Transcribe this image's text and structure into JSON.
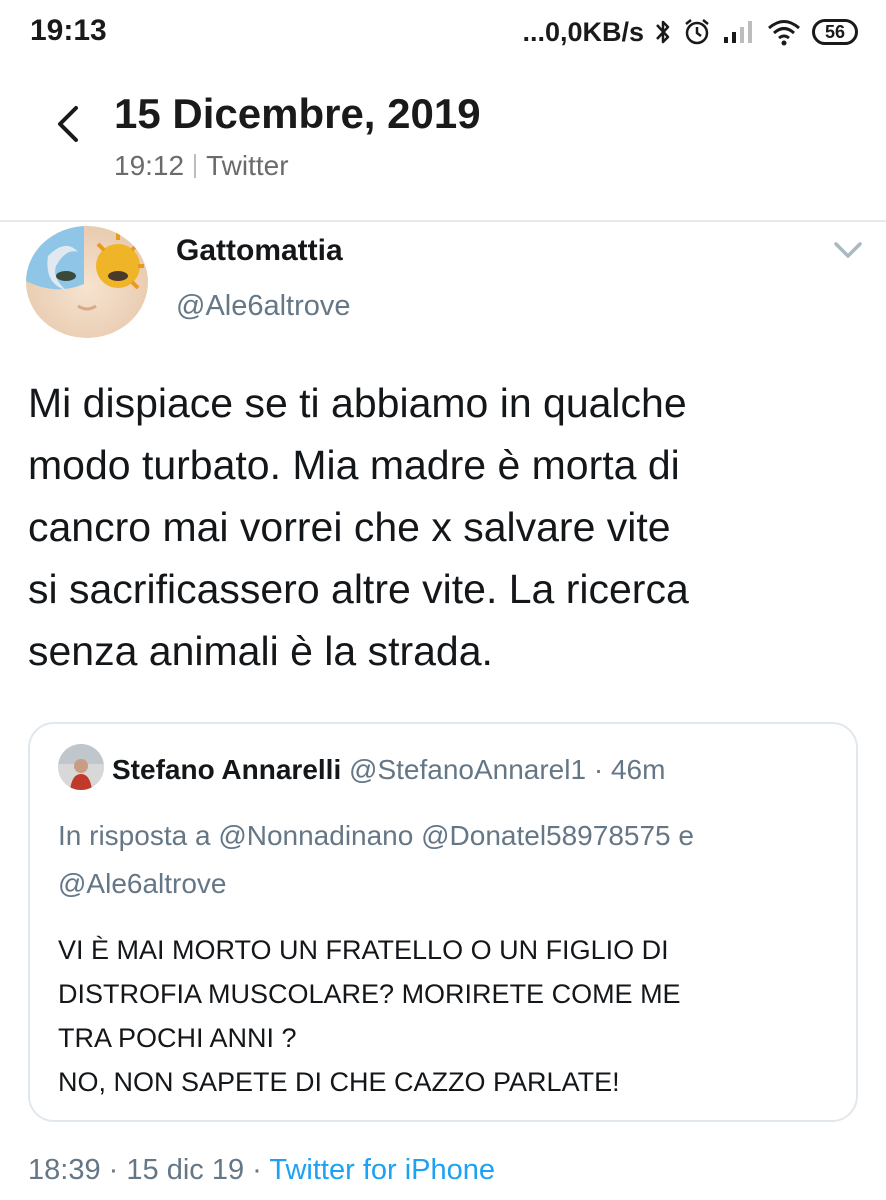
{
  "status_bar": {
    "time": "19:13",
    "speed": "...0,0KB/s",
    "battery": "56"
  },
  "header": {
    "title": "15 Dicembre, 2019",
    "sub_time": "19:12",
    "sub_source": "Twitter"
  },
  "tweet": {
    "author_name": "Gattomattia",
    "author_handle": "@Ale6altrove",
    "text": "Mi dispiace se ti abbiamo in qualche\nmodo turbato. Mia madre è morta di\ncancro mai vorrei che x salvare vite\nsi sacrificassero altre vite. La ricerca\nsenza animali è la strada.",
    "time": "18:39",
    "date": "15 dic 19",
    "source": "Twitter for iPhone"
  },
  "quoted_tweet": {
    "author_name": "Stefano Annarelli",
    "author_handle": "@StefanoAnnarel1",
    "age": "46m",
    "reply_prefix": "In risposta a",
    "reply_handles": "@Nonnadinano @Donatel58978575 e @Ale6altrove",
    "text": "VI È MAI MORTO UN FRATELLO O UN FIGLIO DI\nDISTROFIA MUSCOLARE? MORIRETE COME ME\nTRA POCHI ANNI ?\nNO, NON SAPETE DI CHE CAZZO PARLATE!"
  },
  "colors": {
    "link": "#1da1f2",
    "secondary_text": "#657786",
    "border": "#e1e8ed"
  },
  "icons": [
    "back-arrow-icon",
    "chevron-down-icon",
    "bluetooth-icon",
    "alarm-icon",
    "signal-icon",
    "wifi-icon",
    "battery-icon"
  ]
}
